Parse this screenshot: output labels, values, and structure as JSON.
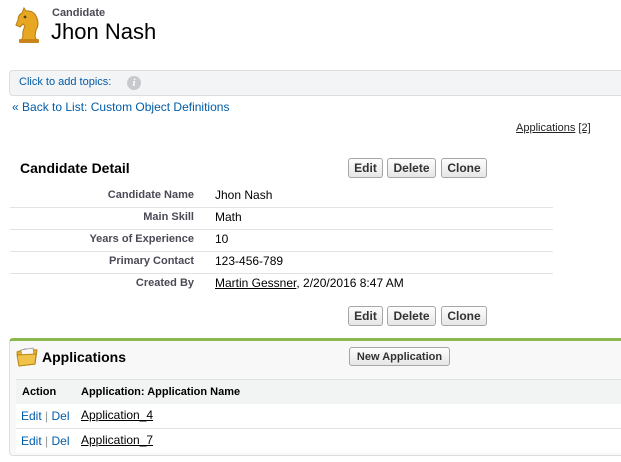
{
  "header": {
    "object_type": "Candidate",
    "record_name": "Jhon Nash"
  },
  "topics": {
    "label": "Click to add topics:",
    "info_icon": "info-icon"
  },
  "back_link": {
    "prefix": "«",
    "text": "Back to List: Custom Object Definitions"
  },
  "related_link": {
    "label": "Applications",
    "count": "[2]"
  },
  "detail": {
    "title": "Candidate Detail",
    "buttons": {
      "edit": "Edit",
      "delete": "Delete",
      "clone": "Clone"
    },
    "fields": [
      {
        "label": "Candidate Name",
        "value": "Jhon Nash"
      },
      {
        "label": "Main Skill",
        "value": "Math"
      },
      {
        "label": "Years of Experience",
        "value": "10"
      },
      {
        "label": "Primary Contact",
        "value": "123-456-789"
      }
    ],
    "created_by": {
      "label": "Created By",
      "user": "Martin Gessner",
      "timestamp": ", 2/20/2016 8:47 AM"
    }
  },
  "applications": {
    "title": "Applications",
    "new_button": "New Application",
    "columns": {
      "action": "Action",
      "name": "Application: Application Name"
    },
    "rows": [
      {
        "edit": "Edit",
        "sep": "|",
        "del": "Del",
        "name": "Application_4"
      },
      {
        "edit": "Edit",
        "sep": "|",
        "del": "Del",
        "name": "Application_7"
      }
    ]
  },
  "colors": {
    "link": "#015ba7",
    "section_accent": "#8bb84e",
    "topics_bg": "#f3f4f6"
  }
}
